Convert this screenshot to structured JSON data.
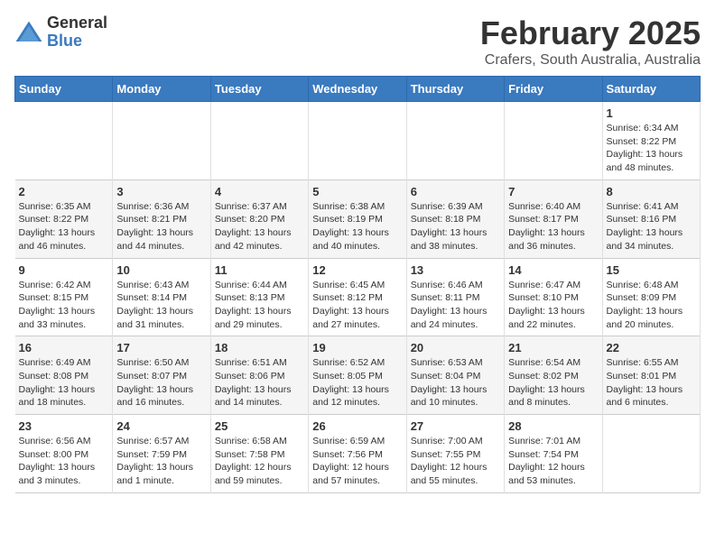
{
  "logo": {
    "general": "General",
    "blue": "Blue"
  },
  "title": "February 2025",
  "subtitle": "Crafers, South Australia, Australia",
  "headers": [
    "Sunday",
    "Monday",
    "Tuesday",
    "Wednesday",
    "Thursday",
    "Friday",
    "Saturday"
  ],
  "weeks": [
    [
      {
        "day": "",
        "info": ""
      },
      {
        "day": "",
        "info": ""
      },
      {
        "day": "",
        "info": ""
      },
      {
        "day": "",
        "info": ""
      },
      {
        "day": "",
        "info": ""
      },
      {
        "day": "",
        "info": ""
      },
      {
        "day": "1",
        "info": "Sunrise: 6:34 AM\nSunset: 8:22 PM\nDaylight: 13 hours\nand 48 minutes."
      }
    ],
    [
      {
        "day": "2",
        "info": "Sunrise: 6:35 AM\nSunset: 8:22 PM\nDaylight: 13 hours\nand 46 minutes."
      },
      {
        "day": "3",
        "info": "Sunrise: 6:36 AM\nSunset: 8:21 PM\nDaylight: 13 hours\nand 44 minutes."
      },
      {
        "day": "4",
        "info": "Sunrise: 6:37 AM\nSunset: 8:20 PM\nDaylight: 13 hours\nand 42 minutes."
      },
      {
        "day": "5",
        "info": "Sunrise: 6:38 AM\nSunset: 8:19 PM\nDaylight: 13 hours\nand 40 minutes."
      },
      {
        "day": "6",
        "info": "Sunrise: 6:39 AM\nSunset: 8:18 PM\nDaylight: 13 hours\nand 38 minutes."
      },
      {
        "day": "7",
        "info": "Sunrise: 6:40 AM\nSunset: 8:17 PM\nDaylight: 13 hours\nand 36 minutes."
      },
      {
        "day": "8",
        "info": "Sunrise: 6:41 AM\nSunset: 8:16 PM\nDaylight: 13 hours\nand 34 minutes."
      }
    ],
    [
      {
        "day": "9",
        "info": "Sunrise: 6:42 AM\nSunset: 8:15 PM\nDaylight: 13 hours\nand 33 minutes."
      },
      {
        "day": "10",
        "info": "Sunrise: 6:43 AM\nSunset: 8:14 PM\nDaylight: 13 hours\nand 31 minutes."
      },
      {
        "day": "11",
        "info": "Sunrise: 6:44 AM\nSunset: 8:13 PM\nDaylight: 13 hours\nand 29 minutes."
      },
      {
        "day": "12",
        "info": "Sunrise: 6:45 AM\nSunset: 8:12 PM\nDaylight: 13 hours\nand 27 minutes."
      },
      {
        "day": "13",
        "info": "Sunrise: 6:46 AM\nSunset: 8:11 PM\nDaylight: 13 hours\nand 24 minutes."
      },
      {
        "day": "14",
        "info": "Sunrise: 6:47 AM\nSunset: 8:10 PM\nDaylight: 13 hours\nand 22 minutes."
      },
      {
        "day": "15",
        "info": "Sunrise: 6:48 AM\nSunset: 8:09 PM\nDaylight: 13 hours\nand 20 minutes."
      }
    ],
    [
      {
        "day": "16",
        "info": "Sunrise: 6:49 AM\nSunset: 8:08 PM\nDaylight: 13 hours\nand 18 minutes."
      },
      {
        "day": "17",
        "info": "Sunrise: 6:50 AM\nSunset: 8:07 PM\nDaylight: 13 hours\nand 16 minutes."
      },
      {
        "day": "18",
        "info": "Sunrise: 6:51 AM\nSunset: 8:06 PM\nDaylight: 13 hours\nand 14 minutes."
      },
      {
        "day": "19",
        "info": "Sunrise: 6:52 AM\nSunset: 8:05 PM\nDaylight: 13 hours\nand 12 minutes."
      },
      {
        "day": "20",
        "info": "Sunrise: 6:53 AM\nSunset: 8:04 PM\nDaylight: 13 hours\nand 10 minutes."
      },
      {
        "day": "21",
        "info": "Sunrise: 6:54 AM\nSunset: 8:02 PM\nDaylight: 13 hours\nand 8 minutes."
      },
      {
        "day": "22",
        "info": "Sunrise: 6:55 AM\nSunset: 8:01 PM\nDaylight: 13 hours\nand 6 minutes."
      }
    ],
    [
      {
        "day": "23",
        "info": "Sunrise: 6:56 AM\nSunset: 8:00 PM\nDaylight: 13 hours\nand 3 minutes."
      },
      {
        "day": "24",
        "info": "Sunrise: 6:57 AM\nSunset: 7:59 PM\nDaylight: 13 hours\nand 1 minute."
      },
      {
        "day": "25",
        "info": "Sunrise: 6:58 AM\nSunset: 7:58 PM\nDaylight: 12 hours\nand 59 minutes."
      },
      {
        "day": "26",
        "info": "Sunrise: 6:59 AM\nSunset: 7:56 PM\nDaylight: 12 hours\nand 57 minutes."
      },
      {
        "day": "27",
        "info": "Sunrise: 7:00 AM\nSunset: 7:55 PM\nDaylight: 12 hours\nand 55 minutes."
      },
      {
        "day": "28",
        "info": "Sunrise: 7:01 AM\nSunset: 7:54 PM\nDaylight: 12 hours\nand 53 minutes."
      },
      {
        "day": "",
        "info": ""
      }
    ]
  ]
}
